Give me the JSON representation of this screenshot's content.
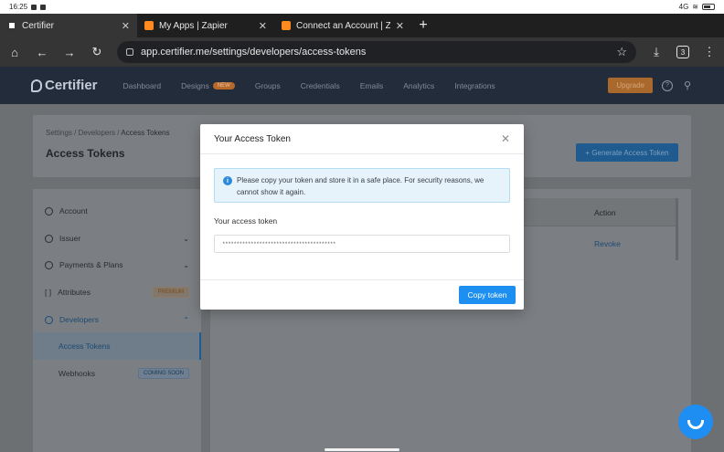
{
  "statusbar": {
    "time": "16:25",
    "right_text": "4G"
  },
  "browser": {
    "tabs": [
      {
        "label": "Certifier",
        "favicon": "certifier"
      },
      {
        "label": "My Apps | Zapier",
        "favicon": "zapier"
      },
      {
        "label": "Connect an Account | Zapier",
        "favicon": "zapier"
      }
    ],
    "url": "app.certifier.me/settings/developers/access-tokens",
    "tab_count": "3"
  },
  "appnav": {
    "logo": "Certifier",
    "links": [
      "Dashboard",
      "Designs",
      "Groups",
      "Credentials",
      "Emails",
      "Analytics",
      "Integrations"
    ],
    "designs_badge": "NEW",
    "upgrade": "Upgrade"
  },
  "page": {
    "breadcrumb": [
      "Settings",
      "Developers",
      "Access Tokens"
    ],
    "title": "Access Tokens",
    "generate_button": "+ Generate Access Token",
    "sidebar": {
      "items": [
        {
          "label": "Account"
        },
        {
          "label": "Issuer"
        },
        {
          "label": "Payments & Plans"
        },
        {
          "label": "Attributes",
          "pill": "PREMIUM"
        },
        {
          "label": "Developers"
        },
        {
          "label": "Access Tokens"
        },
        {
          "label": "Webhooks",
          "pill": "COMING SOON"
        }
      ]
    },
    "table": {
      "action_header": "Action",
      "revoke": "Revoke"
    }
  },
  "modal": {
    "title": "Your Access Token",
    "alert": "Please copy your token and store it in a safe place. For security reasons, we cannot show it again.",
    "token_label": "Your access token",
    "token_value": "****************************************",
    "copy_button": "Copy token"
  },
  "colors": {
    "primary": "#1c8ff0",
    "nav_bg": "#232c3b",
    "overlay": "#6d7073"
  }
}
